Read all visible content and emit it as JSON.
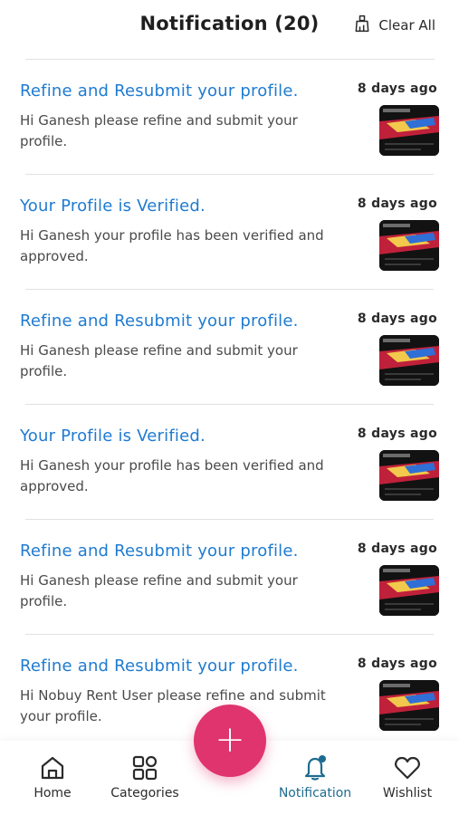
{
  "header": {
    "title": "Notification (20)",
    "clear_all": "Clear All"
  },
  "notifications": [
    {
      "title": "Refine and Resubmit your profile.",
      "time": "8 days ago",
      "body": "Hi Ganesh  please refine and submit your profile."
    },
    {
      "title": "Your Profile is Verified.",
      "time": "8 days ago",
      "body": "Hi Ganesh  your profile has  been verified and approved."
    },
    {
      "title": "Refine and Resubmit your profile.",
      "time": "8 days ago",
      "body": "Hi Ganesh  please refine and submit your profile."
    },
    {
      "title": "Your Profile is Verified.",
      "time": "8 days ago",
      "body": "Hi Ganesh  your profile has  been verified and approved."
    },
    {
      "title": "Refine and Resubmit your profile.",
      "time": "8 days ago",
      "body": "Hi Ganesh please refine and submit your profile."
    },
    {
      "title": "Refine and Resubmit your profile.",
      "time": "8 days ago",
      "body": "Hi Nobuy Rent User please refine and submit your profile."
    }
  ],
  "bottom_nav": {
    "home": "Home",
    "categories": "Categories",
    "notification": "Notification",
    "wishlist": "Wishlist"
  },
  "fab": {
    "icon": "plus-icon"
  },
  "colors": {
    "title_blue": "#1f7bd1",
    "fab_pink": "#e0346e",
    "active_nav": "#1d6c8f"
  }
}
